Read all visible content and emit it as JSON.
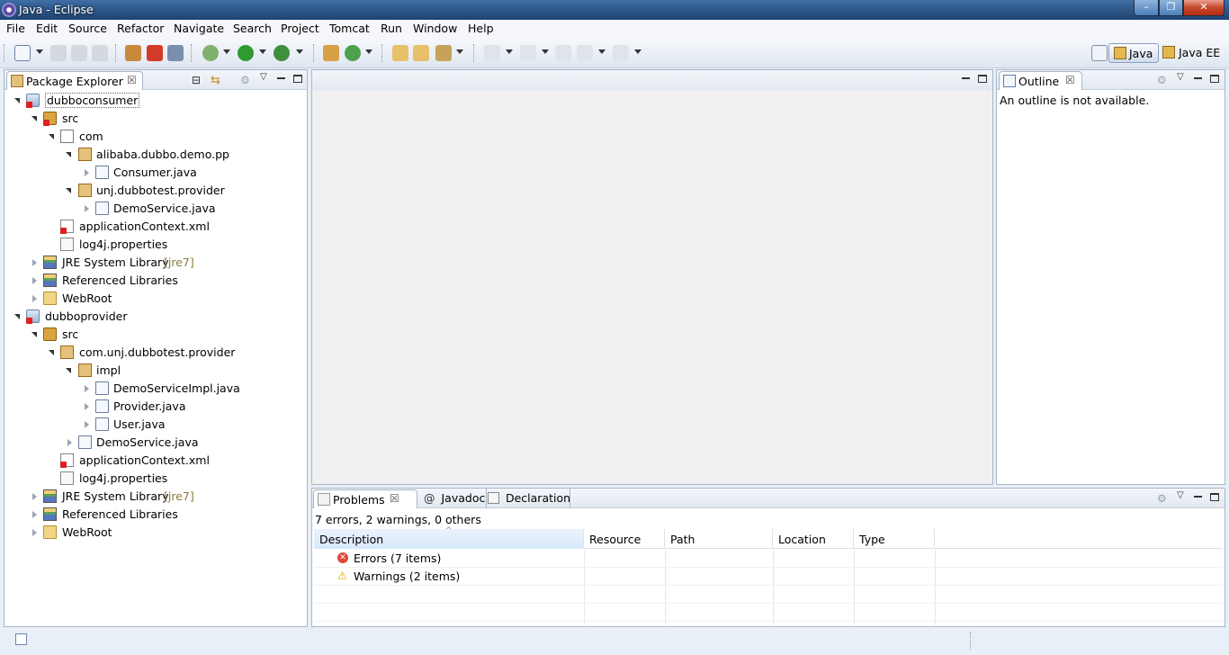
{
  "window": {
    "title": "Java - Eclipse",
    "minimize": "–",
    "maximize": "❐",
    "close": "✕"
  },
  "menu": [
    "File",
    "Edit",
    "Source",
    "Refactor",
    "Navigate",
    "Search",
    "Project",
    "Tomcat",
    "Run",
    "Window",
    "Help"
  ],
  "perspectives": {
    "java": "Java",
    "javaee": "Java EE"
  },
  "package_explorer": {
    "tab_label": "Package Explorer",
    "tree": [
      {
        "label": "dubboconsumer",
        "deco": ""
      },
      {
        "label": "src",
        "deco": ""
      },
      {
        "label": "com",
        "deco": ""
      },
      {
        "label": "alibaba.dubbo.demo.pp",
        "deco": ""
      },
      {
        "label": "Consumer.java",
        "deco": ""
      },
      {
        "label": "unj.dubbotest.provider",
        "deco": ""
      },
      {
        "label": "DemoService.java",
        "deco": ""
      },
      {
        "label": "applicationContext.xml",
        "deco": ""
      },
      {
        "label": "log4j.properties",
        "deco": ""
      },
      {
        "label": "JRE System Library",
        "deco": "[jre7]"
      },
      {
        "label": "Referenced Libraries",
        "deco": ""
      },
      {
        "label": "WebRoot",
        "deco": ""
      },
      {
        "label": "dubboprovider",
        "deco": ""
      },
      {
        "label": "src",
        "deco": ""
      },
      {
        "label": "com.unj.dubbotest.provider",
        "deco": ""
      },
      {
        "label": "impl",
        "deco": ""
      },
      {
        "label": "DemoServiceImpl.java",
        "deco": ""
      },
      {
        "label": "Provider.java",
        "deco": ""
      },
      {
        "label": "User.java",
        "deco": ""
      },
      {
        "label": "DemoService.java",
        "deco": ""
      },
      {
        "label": "applicationContext.xml",
        "deco": ""
      },
      {
        "label": "log4j.properties",
        "deco": ""
      },
      {
        "label": "JRE System Library",
        "deco": "[jre7]"
      },
      {
        "label": "Referenced Libraries",
        "deco": ""
      },
      {
        "label": "WebRoot",
        "deco": ""
      }
    ]
  },
  "outline": {
    "tab_label": "Outline",
    "message": "An outline is not available."
  },
  "bottom_panel": {
    "tabs": [
      "Problems",
      "Javadoc",
      "Declaration"
    ],
    "summary": "7 errors, 2 warnings, 0 others",
    "columns": [
      "Description",
      "Resource",
      "Path",
      "Location",
      "Type"
    ],
    "rows": [
      {
        "label": "Errors (7 items)"
      },
      {
        "label": "Warnings (2 items)"
      }
    ]
  }
}
